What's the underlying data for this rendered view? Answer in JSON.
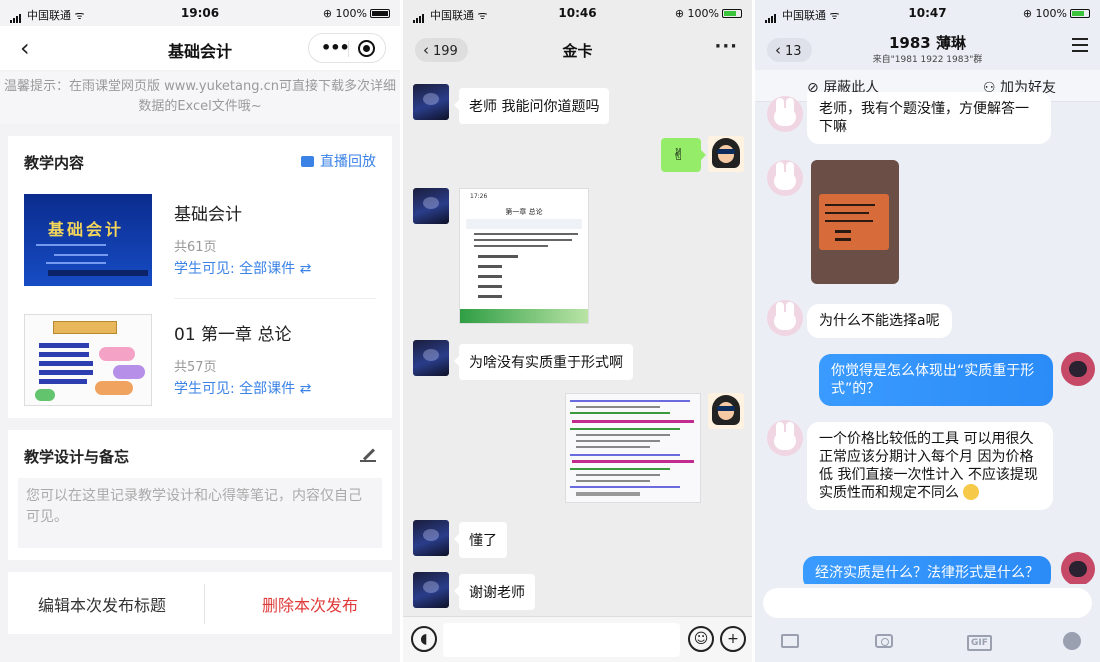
{
  "panel1": {
    "status": {
      "carrier": "中国联通",
      "time": "19:06",
      "battery": "100%"
    },
    "nav_title": "基础会计",
    "tip": "温馨提示：在雨课堂网页版 www.yuketang.cn可直接下载多次详细数据的Excel文件哦~",
    "section_title": "教学内容",
    "live_label": "直播回放",
    "courses": [
      {
        "name": "基础会计",
        "pages": "共61页",
        "visibility": "学生可见: 全部课件 ⇄",
        "thumb_title": "基础会计"
      },
      {
        "name": "01 第一章 总论",
        "pages": "共57页",
        "visibility": "学生可见: 全部课件 ⇄",
        "thumb_title": "第一章 总论"
      }
    ],
    "memo_title": "教学设计与备忘",
    "memo_placeholder": "您可以在这里记录教学设计和心得等笔记，内容仅自己可见。",
    "edit_label": "编辑本次发布标题",
    "delete_label": "删除本次发布"
  },
  "panel2": {
    "status": {
      "carrier": "中国联通",
      "time": "10:46",
      "battery": "100%"
    },
    "back_count": "199",
    "title": "金卡",
    "more": "···",
    "messages": [
      "老师 我能问你道题吗",
      "为啥没有实质重于形式啊",
      "懂了",
      "谢谢老师"
    ],
    "shot_title": "第一章 总论"
  },
  "panel3": {
    "status": {
      "carrier": "中国联通",
      "time": "10:47",
      "battery": "100%"
    },
    "back_count": "13",
    "contact_name": "1983 薄琳",
    "contact_sub": "来自\"1981 1922 1983\"群",
    "block_label": "屏蔽此人",
    "add_friend_label": "加为好友",
    "messages": [
      "老师，我有个题没懂，方便解答一下嘛",
      "为什么不能选择a呢",
      "你觉得是怎么体现出“实质重于形式”的？",
      "一个价格比较低的工具 可以用很久 正常应该分期计入每个月 因为价格低 我们直接一次性计入 不应该提现实质性而和规定不同么",
      "经济实质是什么？法律形式是什么？"
    ],
    "gif_label": "GIF"
  }
}
